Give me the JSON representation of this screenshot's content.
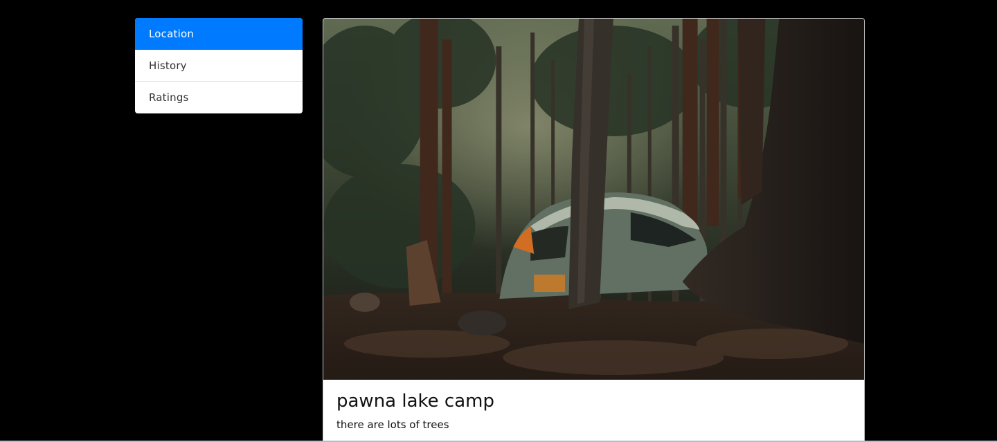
{
  "sidebar": {
    "items": [
      {
        "label": "Location",
        "active": true
      },
      {
        "label": "History",
        "active": false
      },
      {
        "label": "Ratings",
        "active": false
      }
    ]
  },
  "card": {
    "title": "pawna lake camp",
    "text": "there are lots of trees",
    "image": "tent-in-forest-photo"
  },
  "colors": {
    "background": "#000000",
    "active_item": "#007bff",
    "card_background": "#ffffff"
  }
}
